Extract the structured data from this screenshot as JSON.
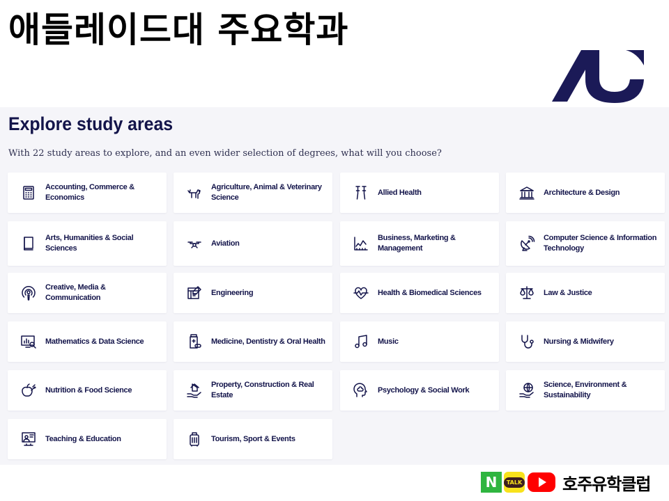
{
  "page": {
    "korean_title": "애들레이드대 주요학과",
    "heading": "Explore study areas",
    "subtitle": "With 22 study areas to explore, and an even wider selection of degrees, what will you choose?"
  },
  "colors": {
    "navy": "#13144a",
    "panel_bg": "#f5f5f9",
    "card_bg": "#ffffff",
    "naver_green": "#2fb540",
    "kakao_yellow": "#f8e21c",
    "youtube_red": "#ff0000"
  },
  "study_areas": [
    {
      "label": "Accounting, Commerce & Economics",
      "icon": "calculator-icon"
    },
    {
      "label": "Agriculture, Animal & Veterinary Science",
      "icon": "dog-icon"
    },
    {
      "label": "Allied Health",
      "icon": "crutches-icon"
    },
    {
      "label": "Architecture & Design",
      "icon": "building-columns-icon"
    },
    {
      "label": "Arts, Humanities & Social Sciences",
      "icon": "book-icon"
    },
    {
      "label": "Aviation",
      "icon": "drone-icon"
    },
    {
      "label": "Business, Marketing & Management",
      "icon": "line-chart-icon"
    },
    {
      "label": "Computer Science & Information Technology",
      "icon": "satellite-dish-icon"
    },
    {
      "label": "Creative, Media & Communication",
      "icon": "podcast-icon"
    },
    {
      "label": "Engineering",
      "icon": "blueprint-icon"
    },
    {
      "label": "Health & Biomedical Sciences",
      "icon": "heartbeat-icon"
    },
    {
      "label": "Law & Justice",
      "icon": "scales-icon"
    },
    {
      "label": "Mathematics & Data Science",
      "icon": "chart-magnifier-icon"
    },
    {
      "label": "Medicine, Dentistry & Oral Health",
      "icon": "medicine-bottle-icon"
    },
    {
      "label": "Music",
      "icon": "music-note-icon"
    },
    {
      "label": "Nursing & Midwifery",
      "icon": "stethoscope-icon"
    },
    {
      "label": "Nutrition & Food Science",
      "icon": "apple-carrot-icon"
    },
    {
      "label": "Property, Construction & Real Estate",
      "icon": "hand-house-icon"
    },
    {
      "label": "Psychology & Social Work",
      "icon": "head-brain-icon"
    },
    {
      "label": "Science, Environment & Sustainability",
      "icon": "hand-globe-icon"
    },
    {
      "label": "Teaching & Education",
      "icon": "presentation-icon"
    },
    {
      "label": "Tourism, Sport & Events",
      "icon": "luggage-icon"
    }
  ],
  "footer": {
    "naver_badge": "N",
    "kakao_badge": "TALK",
    "brand_text": "호주유학클럽"
  }
}
